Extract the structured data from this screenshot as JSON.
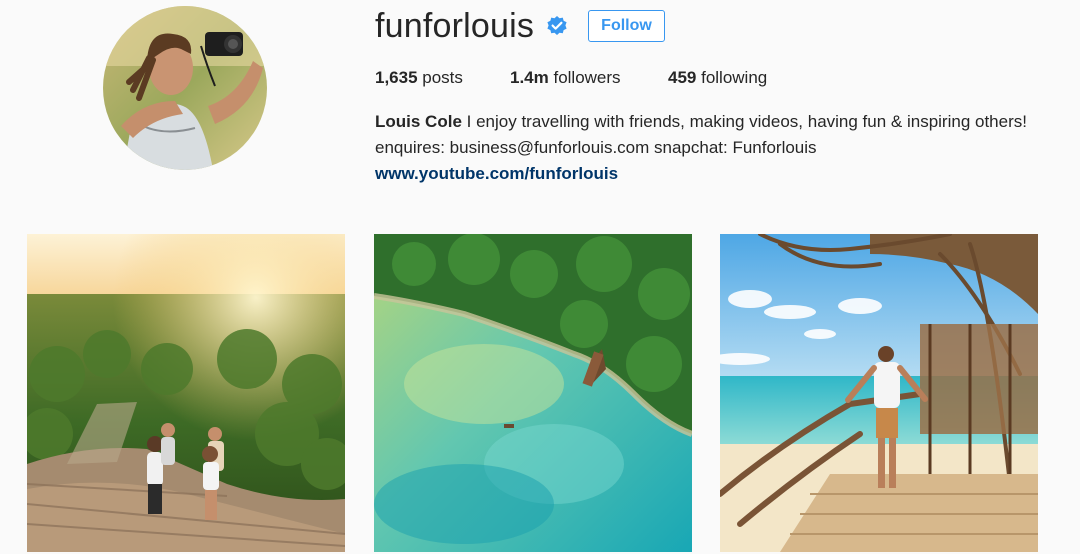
{
  "profile": {
    "username": "funforlouis",
    "follow_label": "Follow",
    "stats": {
      "posts_count": "1,635",
      "posts_label": " posts",
      "followers_count": "1.4m",
      "followers_label": " followers",
      "following_count": "459",
      "following_label": " following"
    },
    "bio": {
      "name": "Louis Cole",
      "text": " I enjoy travelling with friends, making videos, having fun & inspiring others! enquires: business@funforlouis.com snapchat: Funforlouis",
      "link": "www.youtube.com/funforlouis"
    }
  },
  "posts": [
    {
      "description": "hikers-on-pyramid-jungle-sunset"
    },
    {
      "description": "aerial-turquoise-lagoon-jungle"
    },
    {
      "description": "man-on-wooden-deck-beach"
    }
  ],
  "colors": {
    "accent": "#3897f0",
    "link": "#003569",
    "text": "#262626",
    "background": "#fafafa"
  },
  "icons": {
    "verified": "verified-badge-icon"
  }
}
